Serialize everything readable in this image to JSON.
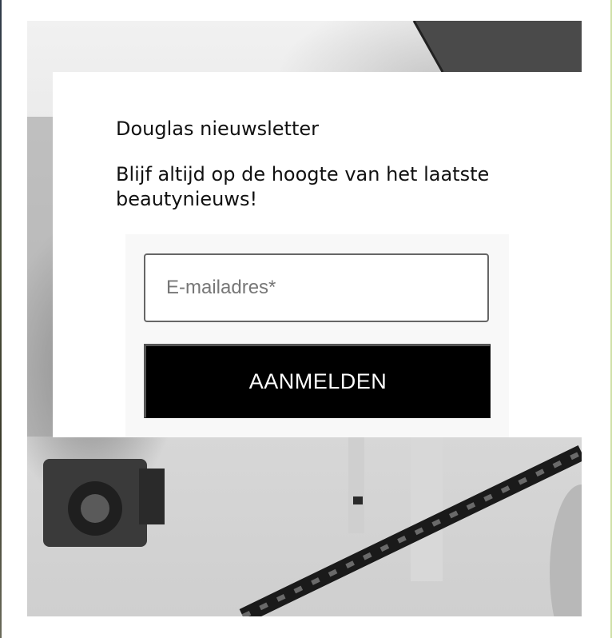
{
  "newsletter": {
    "title": "Douglas nieuwsletter",
    "subtitle": "Blijf altijd op de hoogte van het laatste beautynieuws!",
    "email": {
      "value": "",
      "placeholder": "E-mailadres*"
    },
    "submit_label": "AANMELDEN"
  },
  "colors": {
    "button_background": "#000000",
    "button_text": "#ffffff",
    "card_background": "#ffffff",
    "form_panel_background": "#f8f8f8"
  }
}
